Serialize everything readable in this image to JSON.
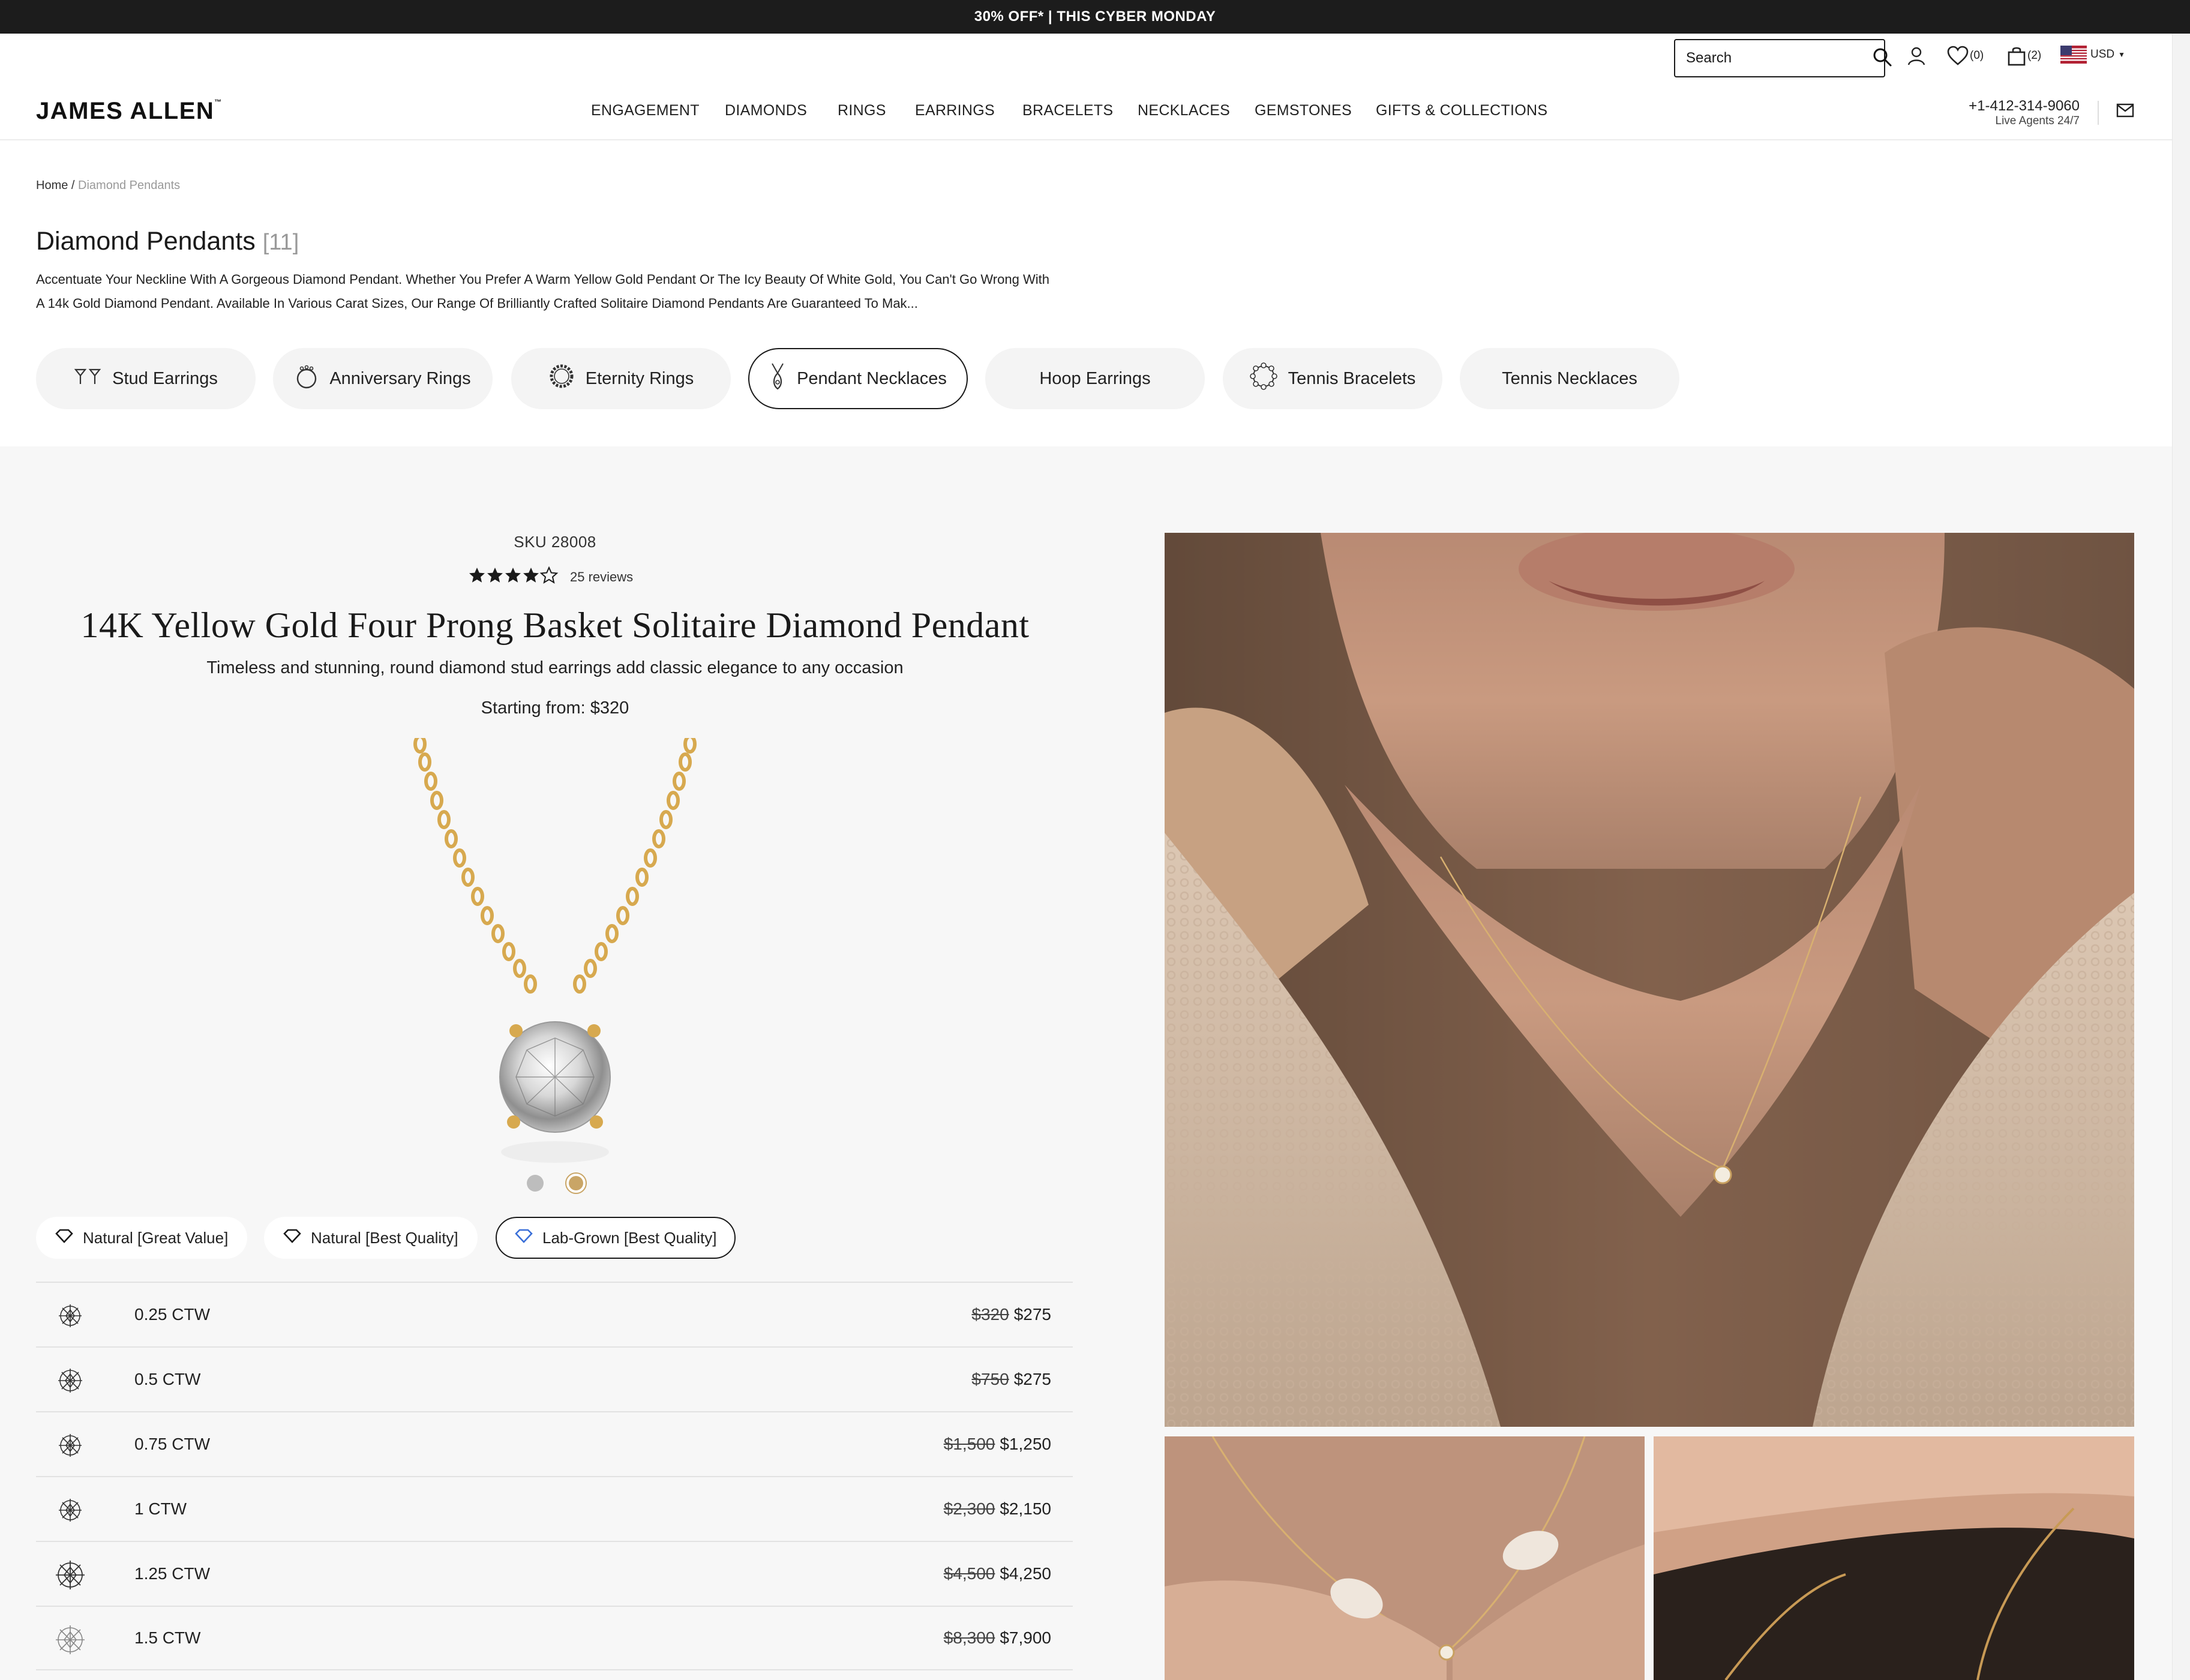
{
  "promo": {
    "text": "30% OFF* | THIS CYBER MONDAY"
  },
  "utility": {
    "search_placeholder": "Search",
    "wishlist_count": "(0)",
    "cart_count": "(2)",
    "currency": "USD"
  },
  "header": {
    "logo": "JAMES ALLEN",
    "nav": [
      "ENGAGEMENT",
      "DIAMONDS",
      "RINGS",
      "EARRINGS",
      "BRACELETS",
      "NECKLACES",
      "GEMSTONES",
      "GIFTS & COLLECTIONS"
    ],
    "phone": "+1-412-314-9060",
    "phone_note": "Live Agents 24/7"
  },
  "breadcrumb": {
    "home": "Home",
    "separator": " / ",
    "current": "Diamond Pendants"
  },
  "category": {
    "title": "Diamond Pendants",
    "count": "[11]",
    "description": "Accentuate Your Neckline With A Gorgeous Diamond Pendant. Whether You Prefer A Warm Yellow Gold Pendant Or The Icy Beauty Of White Gold, You Can't Go Wrong With A 14k Gold Diamond Pendant. Available In Various Carat Sizes, Our Range Of Brilliantly Crafted Solitaire Diamond Pendants Are Guaranteed To Mak..."
  },
  "chips": [
    {
      "label": "Stud Earrings",
      "icon": "stud-earrings-icon"
    },
    {
      "label": "Anniversary Rings",
      "icon": "ring-icon"
    },
    {
      "label": "Eternity Rings",
      "icon": "eternity-ring-icon"
    },
    {
      "label": "Pendant Necklaces",
      "icon": "pendant-icon",
      "active": true
    },
    {
      "label": "Hoop Earrings",
      "icon": ""
    },
    {
      "label": "Tennis Bracelets",
      "icon": "bracelet-icon"
    },
    {
      "label": "Tennis Necklaces",
      "icon": ""
    }
  ],
  "product": {
    "sku": "SKU 28008",
    "rating": 4,
    "rating_max": 5,
    "reviews": "25 reviews",
    "title": "14K Yellow Gold Four Prong Basket Solitaire Diamond Pendant",
    "subtitle": "Timeless and stunning, round diamond stud earrings add classic elegance to any occasion",
    "starting": "Starting from: $320",
    "metal_swatches": [
      {
        "name": "white-gold",
        "color": "#bdbdbd"
      },
      {
        "name": "yellow-gold",
        "color": "#c9a566",
        "selected": true
      }
    ],
    "quality_options": [
      {
        "label": "Natural [Great Value]"
      },
      {
        "label": "Natural [Best Quality]"
      },
      {
        "label": "Lab-Grown [Best Quality]",
        "active": true
      }
    ],
    "sizes": [
      {
        "ctw": "0.25 CTW",
        "old": "$320",
        "price": "$275"
      },
      {
        "ctw": "0.5 CTW",
        "old": "$750",
        "price": "$275"
      },
      {
        "ctw": "0.75 CTW",
        "old": "$1,500",
        "price": "$1,250"
      },
      {
        "ctw": "1 CTW",
        "old": "$2,300",
        "price": "$2,150"
      },
      {
        "ctw": "1.25 CTW",
        "old": "$4,500",
        "price": "$4,250"
      },
      {
        "ctw": "1.5 CTW",
        "old": "$8,300",
        "price": "$7,900"
      }
    ]
  },
  "colors": {
    "accent": "#1a1a1a",
    "gold": "#d7a94f",
    "section_bg": "#f7f7f7"
  }
}
